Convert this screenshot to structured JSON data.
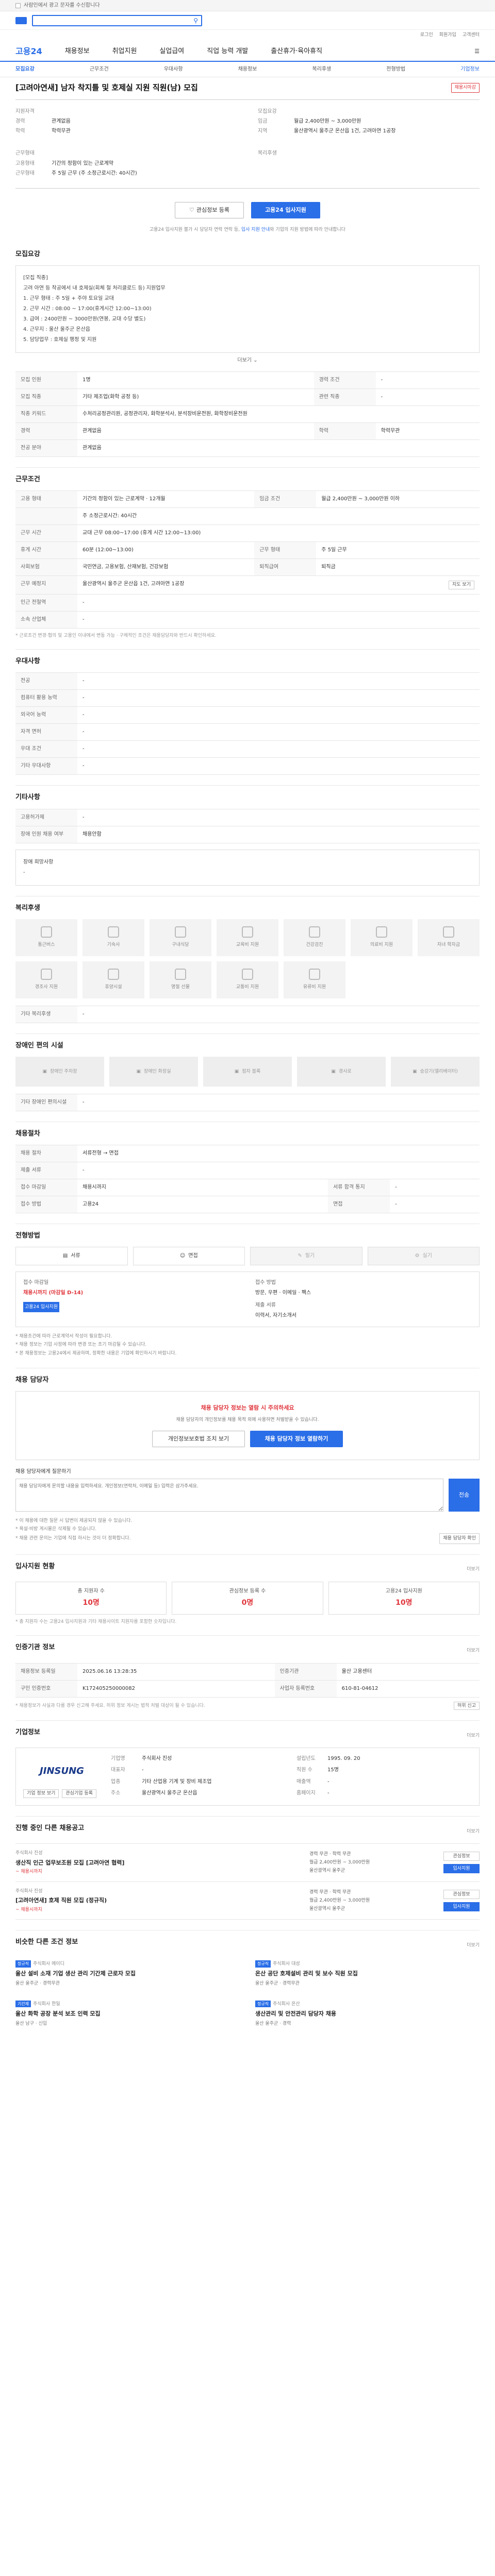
{
  "notice": {
    "text": "사람인에서 광고 문자를 수신합니다"
  },
  "header": {
    "search_icon": "search-icon"
  },
  "util": [
    "로그인",
    "회원가입",
    "고객센터"
  ],
  "gnb": {
    "brand": "고용24",
    "items": [
      "채용정보",
      "취업지원",
      "실업급여",
      "직업 능력 개발",
      "출산휴가·육아휴직"
    ]
  },
  "lnb": {
    "items": [
      "모집요강",
      "근무조건",
      "우대사항",
      "채용정보",
      "복리후생",
      "전형방법",
      "기업정보"
    ],
    "active_index": 0
  },
  "job": {
    "title": "[고려아연새] 남자 착지틀 및 호제실 지원 직원(남) 모집",
    "badge": "채용시마감",
    "summary_left": [
      {
        "k": "지원자격",
        "v": ""
      },
      {
        "k": "경력",
        "v": "관계없음"
      },
      {
        "k": "학력",
        "v": "학력무관"
      }
    ],
    "summary_right": [
      {
        "k": "모집요강",
        "v": ""
      },
      {
        "k": "임금",
        "v": "월급 2,400만원 ~ 3,000만원"
      },
      {
        "k": "지역",
        "v": "울산광역시 울주군 온산읍 1건, 고려아연 1공장"
      }
    ],
    "conditions_label": "근무형태",
    "conditions": [
      {
        "k": "고용형태",
        "v": "기간의 정함이 있는 근로계약"
      },
      {
        "k": "근무형태",
        "v": "주 5일 근무 (주 소정근로시간: 40시간)"
      }
    ],
    "prefer_label": "복리후생"
  },
  "actions": {
    "scrap": "관심정보 등록",
    "apply": "고용24 입사지원",
    "note_prefix": "고용24 입사지원 불가 시 당당자 연락 연락 등, ",
    "note_link": "입사 지원 안내",
    "note_suffix": "와 기업의 지원 방법에 따라 안내합니다"
  },
  "recruit": {
    "title": "모집요강",
    "req_lines": [
      "[모집 직종]",
      "고려 아연 등 착공에서 내 호제실(회체 철 처리클로드 등) 지원업무",
      "1. 근무 형태 : 주 5일 + 주야 토요일 교대",
      "2. 근무 시간 : 08:00 ~ 17:00(휴게시간 12:00~13:00)",
      "3. 급여 : 2400만원 ~ 3000만원(연봉, 교대 수당 별도)",
      "4. 근무지 : 울산 울주군 온산읍",
      "5. 담당업무 : 호제실 행정 및 지원"
    ],
    "more": "더보기",
    "rows": [
      {
        "k": "모집 인원",
        "v": "1명",
        "k2": "경력 조건",
        "v2": "-"
      },
      {
        "k": "모집 직종",
        "v": "기타 제조업(화학 공정 등)",
        "k2": "관련 직종",
        "v2": "-"
      },
      {
        "k": "직종 키워드",
        "v": "수처리공정관리원, 공정관리자, 화학분석사, 분석장비운전원, 화학장비운전원",
        "k2": "",
        "v2": ""
      },
      {
        "k": "경력",
        "v": "관계없음",
        "k2": "학력",
        "v2": "학력무관"
      },
      {
        "k": "전공 분야",
        "v": "관계없음",
        "k2": "",
        "v2": ""
      }
    ]
  },
  "work": {
    "title": "근무조건",
    "rows": [
      {
        "k": "고용 형태",
        "v": "기간의 정함이 있는 근로계약 · 12개월",
        "k2": "임금 조건",
        "v2": "월급 2,400만원 ~ 3,000만원 이하"
      },
      {
        "k": "",
        "v": "주 소정근로시간: 40시간",
        "k2": "",
        "v2": ""
      },
      {
        "k": "근무 시간",
        "v": "교대 근무 \n08:00~17:00 (휴게 시간 12:00~13:00)",
        "k2": "",
        "v2": ""
      },
      {
        "k": "휴게 시간",
        "v": "60분 (12:00~13:00)",
        "k2": "근무 형태",
        "v2": "주 5일 근무"
      },
      {
        "k": "사회보험",
        "v": "국민연금, 고용보험, 산재보험, 건강보험",
        "k2": "퇴직급여",
        "v2": "퇴직금"
      },
      {
        "k": "근무 예정지",
        "v": "울산광역시 울주군 온산읍 1건, 고려아연 1공장",
        "k2": "",
        "v2": ""
      },
      {
        "k": "인근 전철역",
        "v": "-",
        "k2": "",
        "v2": ""
      },
      {
        "k": "소속 산업체",
        "v": "-",
        "k2": "",
        "v2": ""
      }
    ],
    "map_btn": "지도 보기",
    "note": "* 근로조건 변경·협의 및 고용인 이내에서 변동 가능 · 구체적인 조건은 채용담당자와 반드시 확인하세요."
  },
  "prefer": {
    "title": "우대사항",
    "rows": [
      {
        "k": "전공",
        "v": "-"
      },
      {
        "k": "컴퓨터 활용 능력",
        "v": "-"
      },
      {
        "k": "외국어 능력",
        "v": "-"
      },
      {
        "k": "자격 면허",
        "v": "-"
      },
      {
        "k": "우대 조건",
        "v": "-"
      },
      {
        "k": "기타 우대사항",
        "v": "-"
      }
    ]
  },
  "etc": {
    "title": "기타사항",
    "rows": [
      {
        "k": "고용허가제",
        "v": "-"
      },
      {
        "k": "장애 인원 채용 여부",
        "v": "채용안함"
      },
      {
        "k": "장애 희망사항",
        "v": "-"
      }
    ]
  },
  "welfare": {
    "title": "복리후생",
    "items": [
      "통근버스",
      "기숙사",
      "구내식당",
      "교육비 지원",
      "건강검진",
      "의료비 지원",
      "자녀 학자금",
      "경조사 지원",
      "휴양시설",
      "명절 선물",
      "교통비 지원",
      "유류비 지원"
    ],
    "etc_label": "기타 복리후생",
    "etc_value": "-"
  },
  "disability": {
    "title": "장애인 편의 시설",
    "items": [
      "장애인 주차장",
      "장애인 화장실",
      "점자 블록",
      "경사로",
      "승강기(엘리베이터)"
    ],
    "etc_label": "기타 장애인 편의시설",
    "etc_value": "-"
  },
  "process": {
    "title": "채용절차",
    "rows": [
      {
        "k": "채용 절차",
        "v": "서류전형 → 면접"
      },
      {
        "k": "제출 서류",
        "v": "-"
      },
      {
        "k": "접수 마감일",
        "v": "채용시까지",
        "k2": "서류 합격 통지",
        "v2": "-"
      },
      {
        "k": "접수 방법",
        "v": "고용24",
        "k2": "면접",
        "v2": "-"
      }
    ]
  },
  "apply": {
    "title": "전형방법",
    "methods": [
      "서류",
      "면접",
      "필기",
      "실기"
    ],
    "deadline_label": "접수 마감일",
    "deadline_value": "채용시까지 (마감일 D-14)",
    "apply_btn": "고용24 입사지원",
    "way_label": "접수 방법",
    "way_value": "방문, 우편 · 이메일 · 팩스",
    "form_label": "제출 서류",
    "form_value": "이력서, 자기소개서",
    "notes": [
      "* 채용조건에 따라 근로계약서 작성이 필요합니다.",
      "* 채용 정보는 기업 사정에 따라 변경 또는 조기 마감될 수 있습니다.",
      "* 본 채용정보는 고용24에서 제공하며, 정확한 내용은 기업에 확인하시기 바랍니다."
    ]
  },
  "consult": {
    "title": "채용 담당자",
    "alert": "채용 담당자 정보는 열람 시 주의하세요",
    "desc": "채용 담당자의 개인정보를 채용 목적 외에 사용하면 처벌받을 수 있습니다.",
    "btn1": "개인정보보호법 조치 보기",
    "btn2": "채용 담당자 정보 열람하기",
    "ta_label": "채용 담당자에게 질문하기",
    "ta_placeholder": "채용 담당자에게 문의할 내용을 입력하세요. 개인정보(연락처, 이메일 등) 입력은 삼가주세요.",
    "submit": "전송",
    "notes": [
      "* 이 채용에 대한 질문 시 답변이 제공되지 않을 수 있습니다.",
      "* 욕설·비방 게시물은 삭제될 수 있습니다.",
      "* 채용 관련 문의는 기업에 직접 하시는 것이 더 정확합니다."
    ],
    "check_btn": "채용 담당자 확인"
  },
  "stats": {
    "title": "입사지원 현황",
    "more": "더보기",
    "items": [
      {
        "label": "총 지원자 수",
        "value": "10명"
      },
      {
        "label": "관심정보 등록 수",
        "value": "0명"
      },
      {
        "label": "고용24 입사지원",
        "value": "10명"
      }
    ],
    "note": "* 총 지원자 수는 고용24 입사지원과 기타 채용사이트 지원자를 포함한 숫자입니다."
  },
  "reg": {
    "title": "인증기관 정보",
    "more": "더보기",
    "rows": [
      {
        "k": "채용정보 등록일",
        "v": "2025.06.16 13:28:35",
        "k2": "인증기관",
        "v2": "울산 고용센터"
      },
      {
        "k": "구인 인증번호",
        "v": "K172405250000082",
        "k2": "사업자 등록번호",
        "v2": "610-81-04612"
      }
    ],
    "note": "* 채용정보가 사실과 다를 경우 신고해 주세요. 허위 정보 게시는 법적 처벌 대상이 될 수 있습니다.",
    "report_btn": "허위 신고"
  },
  "company": {
    "title": "기업정보",
    "more": "더보기",
    "logo_text": "JINSUNG",
    "fields": [
      {
        "k": "기업명",
        "v": "주식회사 진성"
      },
      {
        "k": "대표자",
        "v": "-"
      },
      {
        "k": "업종",
        "v": "기타 산업용 기계 및 장비 제조업"
      },
      {
        "k": "설립년도",
        "v": "1995. 09. 20"
      },
      {
        "k": "직원 수",
        "v": "15명"
      },
      {
        "k": "매출액",
        "v": "-"
      },
      {
        "k": "주소",
        "v": "울산광역시 울주군 온산읍"
      },
      {
        "k": "홈페이지",
        "v": "-"
      }
    ],
    "btn_info": "기업 정보 보기",
    "btn_follow": "관심기업 등록"
  },
  "recs": {
    "title": "진행 중인 다른 채용공고",
    "more": "더보기",
    "items": [
      {
        "co": "주식회사 진성",
        "title": "생산직 인근 업무보조원 모집 [고려아연 협력]",
        "date": "~ 채용시까지",
        "m1": "경력 무관 · 학력 무관",
        "m2": "월급 2,400만원 ~ 3,000만원",
        "m3": "울산광역시 울주군"
      },
      {
        "co": "주식회사 진성",
        "title": "[고려아연새] 호제 직원 모집 (정규직)",
        "date": "~ 채용시까지",
        "m1": "경력 무관 · 학력 무관",
        "m2": "월급 2,400만원 ~ 3,000만원",
        "m3": "울산광역시 울주군"
      }
    ],
    "btn_scrap": "관심정보",
    "btn_apply": "입사지원"
  },
  "similar": {
    "title": "비슷한 다른 조건 정보",
    "more": "더보기",
    "items": [
      {
        "tag": "정규직",
        "co": "주식회사 에이디",
        "title": "울산 설비 소재 기업 생산 관리 기간제 근로자 모집",
        "meta": "울산 울주군 · 경력무관"
      },
      {
        "tag": "정규직",
        "co": "주식회사 대성",
        "title": "온산 공단 호제설비 관리 및 보수 직원 모집",
        "meta": "울산 울주군 · 경력무관"
      },
      {
        "tag": "기간제",
        "co": "주식회사 한일",
        "title": "울산 화학 공장 분석 보조 인력 모집",
        "meta": "울산 남구 · 신입"
      },
      {
        "tag": "정규직",
        "co": "주식회사 온산",
        "title": "생산관리 및 안전관리 담당자 채용",
        "meta": "울산 울주군 · 경력"
      }
    ]
  }
}
